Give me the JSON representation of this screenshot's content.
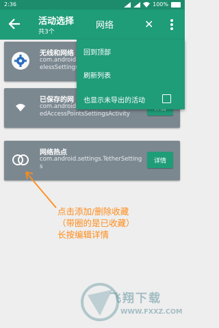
{
  "status": {
    "time": "2:36",
    "battery": "100%"
  },
  "appbar": {
    "title": "活动选择",
    "subtitle": "共3个",
    "search_text": "网络",
    "close_glyph": "✕"
  },
  "menu": {
    "items": [
      "回到顶部",
      "刷新列表",
      "也显示未导出的活动"
    ]
  },
  "cards": [
    {
      "name": "无线和网络",
      "cls": "com.android.settings.Settings$WirelessSettingsActivity\nodeVoiceAct"
    },
    {
      "name": "已保存的网",
      "cls": "com.android.settings.Settings$SavedAccessPointsSettingsActivity",
      "detail": "详情"
    },
    {
      "name": "网络热点",
      "cls": "com.android.settings.TetherSettings",
      "detail": "详情"
    }
  ],
  "annotation": {
    "line1": "点击添加/删除收藏",
    "line2": "（带圈的是已收藏）",
    "line3": "长按编辑详情"
  },
  "watermark": {
    "brand": "飞翔下载",
    "url": "WWW.FXXZ.COM"
  },
  "colors": {
    "primary": "#1f9c78",
    "card": "#7c8890",
    "annotation": "#ff8c1a"
  }
}
